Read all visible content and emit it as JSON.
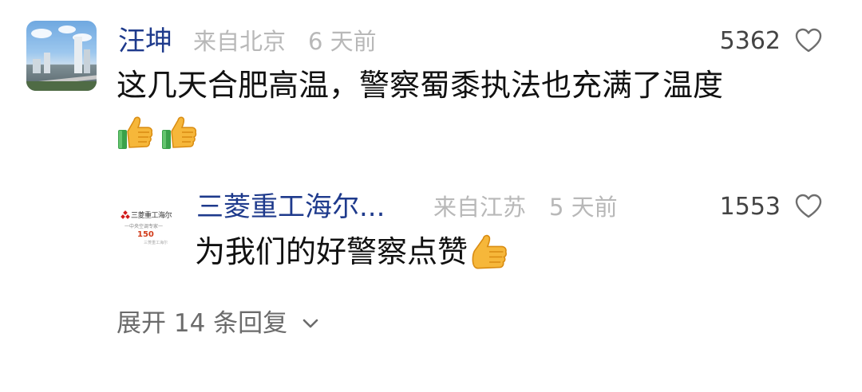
{
  "comment": {
    "username": "汪坤",
    "location": "来自北京",
    "time": "6 天前",
    "likes": "5362",
    "text": "这几天合肥高温，警察蜀黍执法也充满了温度",
    "emoji": [
      "thumbs-up",
      "thumbs-up"
    ]
  },
  "reply": {
    "username": "三菱重工海尔...",
    "location": "来自江苏",
    "time": "5 天前",
    "likes": "1553",
    "text": "为我们的好警察点赞",
    "emoji": [
      "thumbs-up"
    ],
    "avatar_logo": {
      "brand": "三菱重工海尔",
      "tagline": "一中央空调专家一",
      "badge": "150",
      "small": "三菱重工海尔"
    }
  },
  "expand": {
    "label": "展开 14 条回复"
  },
  "colors": {
    "username": "#1e3a8c",
    "meta": "#b8b8b8",
    "text": "#111111",
    "expand": "#6b6b6b"
  },
  "icons": {
    "like": "heart-outline-icon",
    "expand": "chevron-down-icon",
    "emoji": "thumbs-up-emoji"
  }
}
